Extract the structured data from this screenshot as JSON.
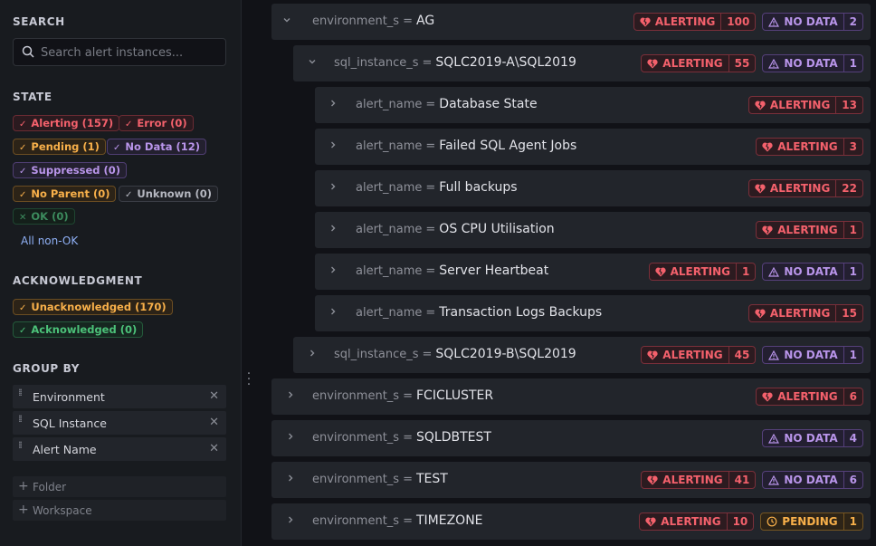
{
  "sidebar": {
    "search": {
      "title": "SEARCH",
      "placeholder": "Search alert instances..."
    },
    "state": {
      "title": "STATE",
      "chips": [
        {
          "label": "Alerting (157)",
          "color": "#f4616c"
        },
        {
          "label": "Error (0)",
          "color": "#f4616c"
        },
        {
          "label": "Pending (1)",
          "color": "#f8b04a"
        },
        {
          "label": "No Data (12)",
          "color": "#b995ea"
        },
        {
          "label": "Suppressed (0)",
          "color": "#b995ea"
        },
        {
          "label": "No Parent (0)",
          "color": "#f8b04a"
        },
        {
          "label": "Unknown (0)",
          "color": "#b5b7c0"
        },
        {
          "label": "OK (0)",
          "color": "#3c8b5d"
        }
      ],
      "all_non_ok": "All non-OK"
    },
    "acknowledgment": {
      "title": "ACKNOWLEDGMENT",
      "chips": [
        {
          "label": "Unacknowledged (170)",
          "color": "#f8b04a"
        },
        {
          "label": "Acknowledged (0)",
          "color": "#4cc279"
        }
      ]
    },
    "group_by": {
      "title": "GROUP BY",
      "items": [
        {
          "label": "Environment"
        },
        {
          "label": "SQL Instance"
        },
        {
          "label": "Alert Name"
        }
      ],
      "add": [
        {
          "label": "Folder"
        },
        {
          "label": "Workspace"
        }
      ]
    }
  },
  "tree": {
    "rows": [
      {
        "key": "environment_s",
        "value": "AG",
        "expanded": true,
        "alerting": {
          "label": "ALERTING",
          "count": "100"
        },
        "nodata": {
          "label": "NO DATA",
          "count": "2"
        }
      },
      {
        "key": "sql_instance_s",
        "value": "SQLC2019-A\\SQL2019",
        "expanded": true,
        "alerting": {
          "label": "ALERTING",
          "count": "55"
        },
        "nodata": {
          "label": "NO DATA",
          "count": "1"
        }
      },
      {
        "key": "alert_name",
        "value": "Database State",
        "alerting": {
          "label": "ALERTING",
          "count": "13"
        }
      },
      {
        "key": "alert_name",
        "value": "Failed SQL Agent Jobs",
        "alerting": {
          "label": "ALERTING",
          "count": "3"
        }
      },
      {
        "key": "alert_name",
        "value": "Full backups",
        "alerting": {
          "label": "ALERTING",
          "count": "22"
        }
      },
      {
        "key": "alert_name",
        "value": "OS CPU Utilisation",
        "alerting": {
          "label": "ALERTING",
          "count": "1"
        }
      },
      {
        "key": "alert_name",
        "value": "Server Heartbeat",
        "alerting": {
          "label": "ALERTING",
          "count": "1"
        },
        "nodata": {
          "label": "NO DATA",
          "count": "1"
        }
      },
      {
        "key": "alert_name",
        "value": "Transaction Logs Backups",
        "alerting": {
          "label": "ALERTING",
          "count": "15"
        }
      },
      {
        "key": "sql_instance_s",
        "value": "SQLC2019-B\\SQL2019",
        "alerting": {
          "label": "ALERTING",
          "count": "45"
        },
        "nodata": {
          "label": "NO DATA",
          "count": "1"
        }
      },
      {
        "key": "environment_s",
        "value": "FCICLUSTER",
        "alerting": {
          "label": "ALERTING",
          "count": "6"
        }
      },
      {
        "key": "environment_s",
        "value": "SQLDBTEST",
        "nodata": {
          "label": "NO DATA",
          "count": "4"
        }
      },
      {
        "key": "environment_s",
        "value": "TEST",
        "alerting": {
          "label": "ALERTING",
          "count": "41"
        },
        "nodata": {
          "label": "NO DATA",
          "count": "6"
        }
      },
      {
        "key": "environment_s",
        "value": "TIMEZONE",
        "alerting": {
          "label": "ALERTING",
          "count": "10"
        },
        "pending": {
          "label": "PENDING",
          "count": "1"
        }
      }
    ]
  },
  "colors": {
    "alerting": "#f4616c",
    "nodata": "#b995ea",
    "pending": "#f8b04a",
    "background": "#111217"
  }
}
